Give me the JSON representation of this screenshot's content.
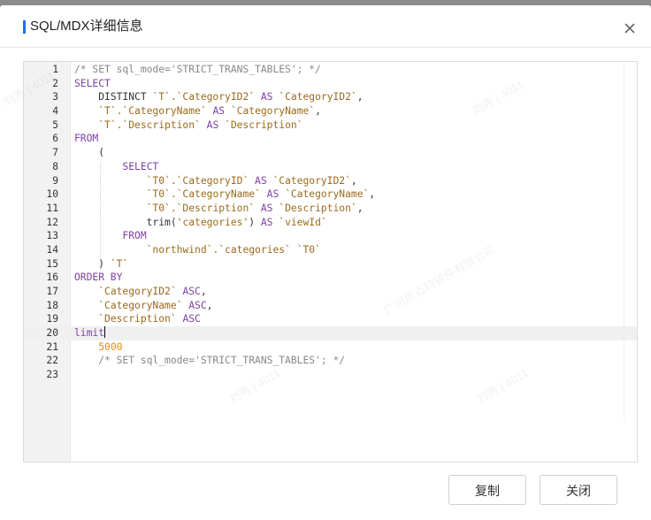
{
  "dialog": {
    "title": "SQL/MDX详细信息",
    "close_icon": "close-icon",
    "accent_color": "#1f6ff5"
  },
  "editor": {
    "active_line": 20,
    "lines": [
      {
        "n": "1",
        "segs": [
          {
            "t": "/* SET sql_mode='STRICT_TRANS_TABLES'; */",
            "c": "cm"
          }
        ]
      },
      {
        "n": "2",
        "segs": [
          {
            "t": "SELECT",
            "c": "kw"
          }
        ]
      },
      {
        "n": "3",
        "segs": [
          {
            "t": "    DISTINCT ",
            "c": "pl"
          },
          {
            "t": "`T`.`CategoryID2`",
            "c": "str"
          },
          {
            "t": " AS ",
            "c": "kw"
          },
          {
            "t": "`CategoryID2`",
            "c": "str"
          },
          {
            "t": ",",
            "c": "pl"
          }
        ]
      },
      {
        "n": "4",
        "segs": [
          {
            "t": "    ",
            "c": "pl"
          },
          {
            "t": "`T`.`CategoryName`",
            "c": "str"
          },
          {
            "t": " AS ",
            "c": "kw"
          },
          {
            "t": "`CategoryName`",
            "c": "str"
          },
          {
            "t": ",",
            "c": "pl"
          }
        ]
      },
      {
        "n": "5",
        "segs": [
          {
            "t": "    ",
            "c": "pl"
          },
          {
            "t": "`T`.`Description`",
            "c": "str"
          },
          {
            "t": " AS ",
            "c": "kw"
          },
          {
            "t": "`Description`",
            "c": "str"
          }
        ]
      },
      {
        "n": "6",
        "segs": [
          {
            "t": "FROM",
            "c": "kw"
          }
        ]
      },
      {
        "n": "7",
        "segs": [
          {
            "t": "    (",
            "c": "pl"
          }
        ]
      },
      {
        "n": "8",
        "segs": [
          {
            "t": "        SELECT",
            "c": "kw"
          }
        ]
      },
      {
        "n": "9",
        "segs": [
          {
            "t": "            ",
            "c": "pl"
          },
          {
            "t": "`T0`.`CategoryID`",
            "c": "str"
          },
          {
            "t": " AS ",
            "c": "kw"
          },
          {
            "t": "`CategoryID2`",
            "c": "str"
          },
          {
            "t": ",",
            "c": "pl"
          }
        ]
      },
      {
        "n": "10",
        "segs": [
          {
            "t": "            ",
            "c": "pl"
          },
          {
            "t": "`T0`.`CategoryName`",
            "c": "str"
          },
          {
            "t": " AS ",
            "c": "kw"
          },
          {
            "t": "`CategoryName`",
            "c": "str"
          },
          {
            "t": ",",
            "c": "pl"
          }
        ]
      },
      {
        "n": "11",
        "segs": [
          {
            "t": "            ",
            "c": "pl"
          },
          {
            "t": "`T0`.`Description`",
            "c": "str"
          },
          {
            "t": " AS ",
            "c": "kw"
          },
          {
            "t": "`Description`",
            "c": "str"
          },
          {
            "t": ",",
            "c": "pl"
          }
        ]
      },
      {
        "n": "12",
        "segs": [
          {
            "t": "            trim(",
            "c": "pl"
          },
          {
            "t": "'categories'",
            "c": "str"
          },
          {
            "t": ") ",
            "c": "pl"
          },
          {
            "t": "AS ",
            "c": "kw"
          },
          {
            "t": "`viewId`",
            "c": "str"
          }
        ]
      },
      {
        "n": "13",
        "segs": [
          {
            "t": "        FROM",
            "c": "kw"
          }
        ]
      },
      {
        "n": "14",
        "segs": [
          {
            "t": "            ",
            "c": "pl"
          },
          {
            "t": "`northwind`.`categories` `T0`",
            "c": "str"
          }
        ]
      },
      {
        "n": "15",
        "segs": [
          {
            "t": "    ) ",
            "c": "pl"
          },
          {
            "t": "`T`",
            "c": "str"
          }
        ]
      },
      {
        "n": "16",
        "segs": [
          {
            "t": "ORDER BY",
            "c": "kw"
          }
        ]
      },
      {
        "n": "17",
        "segs": [
          {
            "t": "    ",
            "c": "pl"
          },
          {
            "t": "`CategoryID2`",
            "c": "str"
          },
          {
            "t": " ASC",
            "c": "kw"
          },
          {
            "t": ",",
            "c": "pl"
          }
        ]
      },
      {
        "n": "18",
        "segs": [
          {
            "t": "    ",
            "c": "pl"
          },
          {
            "t": "`CategoryName`",
            "c": "str"
          },
          {
            "t": " ASC",
            "c": "kw"
          },
          {
            "t": ",",
            "c": "pl"
          }
        ]
      },
      {
        "n": "19",
        "segs": [
          {
            "t": "    ",
            "c": "pl"
          },
          {
            "t": "`Description`",
            "c": "str"
          },
          {
            "t": " ASC",
            "c": "kw"
          }
        ]
      },
      {
        "n": "20",
        "segs": [
          {
            "t": "limit",
            "c": "kw"
          }
        ]
      },
      {
        "n": "21",
        "segs": [
          {
            "t": "    ",
            "c": "pl"
          },
          {
            "t": "5000",
            "c": "num"
          }
        ]
      },
      {
        "n": "22",
        "segs": [
          {
            "t": "    /* SET sql_mode='STRICT_TRANS_TABLES'; */",
            "c": "cm"
          }
        ]
      },
      {
        "n": "23",
        "segs": []
      }
    ]
  },
  "watermarks": [
    "刘秀 | 4011",
    "刘秀 | 4011",
    "广州思迈特软件有限公司",
    "刘秀 | 4011",
    "刘秀 | 4011"
  ],
  "footer": {
    "copy_label": "复制",
    "close_label": "关闭"
  }
}
